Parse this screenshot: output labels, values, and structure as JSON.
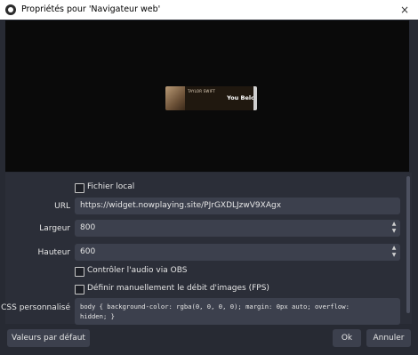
{
  "window": {
    "title": "Propriétés pour 'Navigateur web'",
    "close_glyph": "×"
  },
  "preview": {
    "widget": {
      "artist": "TAYLOR SWIFT",
      "song": "You Belc"
    }
  },
  "form": {
    "local_file": {
      "label": "Fichier local",
      "checked": false
    },
    "url": {
      "label": "URL",
      "value": "https://widget.nowplaying.site/PJrGXDLJzwV9XAgx"
    },
    "width": {
      "label": "Largeur",
      "value": "800"
    },
    "height": {
      "label": "Hauteur",
      "value": "600"
    },
    "control_audio": {
      "label": "Contrôler l'audio via OBS",
      "checked": false
    },
    "manual_fps": {
      "label": "Définir manuellement le débit d'images (FPS)",
      "checked": false
    },
    "custom_css": {
      "label": "CSS personnalisé",
      "line1": "body { background-color: rgba(0, 0, 0, 0); margin: 0px auto; overflow:",
      "line2": "hidden; }"
    }
  },
  "buttons": {
    "defaults": "Valeurs par défaut",
    "ok": "Ok",
    "cancel": "Annuler"
  },
  "icons": {
    "app": "obs-logo-icon",
    "spin_up": "▲",
    "spin_down": "▼"
  }
}
